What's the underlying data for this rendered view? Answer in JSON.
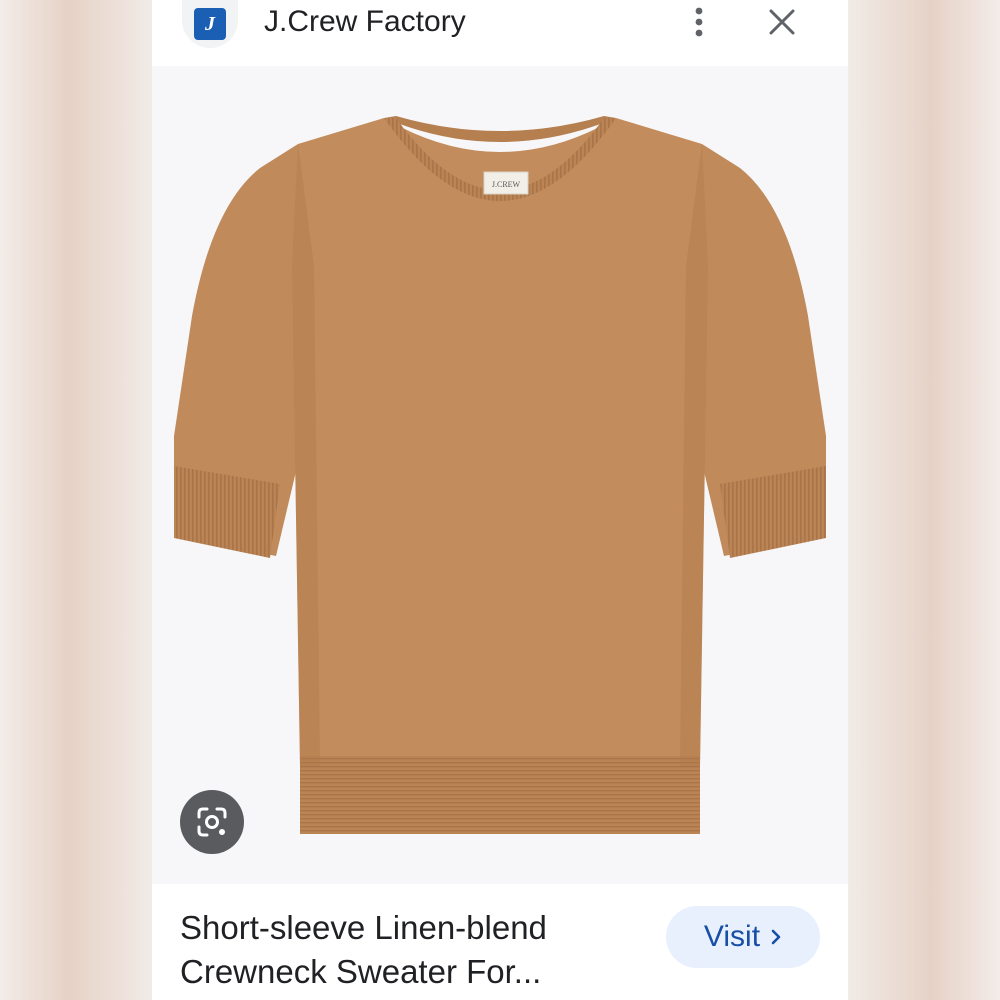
{
  "header": {
    "site_name": "J.Crew Factory",
    "logo_letter": "J"
  },
  "product": {
    "title_line1": "Short-sleeve Linen-blend",
    "title_line2": "Crewneck Sweater For...",
    "label_brand": "J.CREW"
  },
  "actions": {
    "visit_label": "Visit"
  },
  "colors": {
    "sweater": "#c08a5b",
    "visit_bg": "#e8f0fe",
    "visit_text": "#174ea6",
    "logo_blue": "#1a5fb4"
  },
  "icons": [
    "more-vert-icon",
    "close-icon",
    "google-lens-icon",
    "chevron-right-icon"
  ]
}
